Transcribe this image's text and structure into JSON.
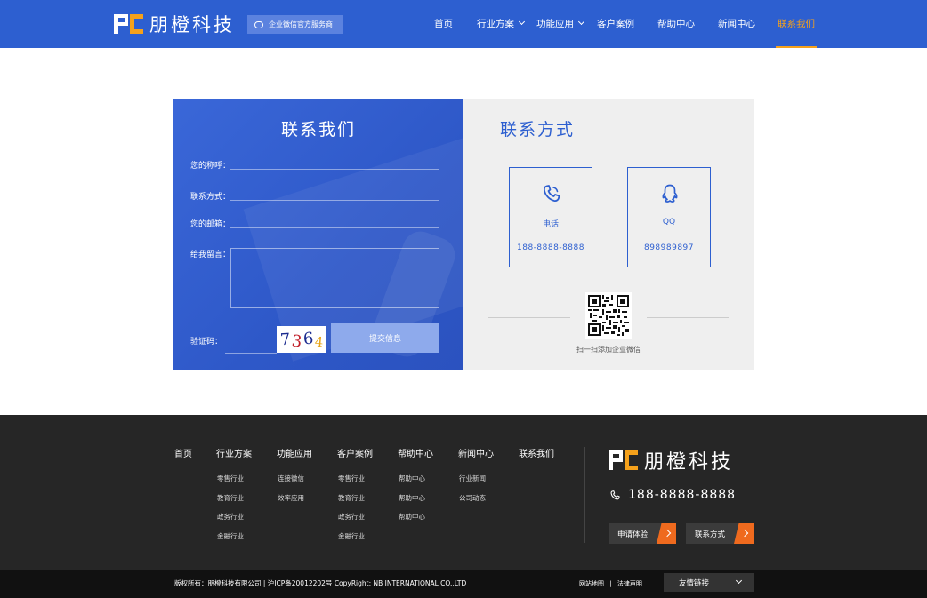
{
  "header": {
    "brand": "朋橙科技",
    "service_badge": "企业微信官方服务商",
    "nav": [
      {
        "label": "首页"
      },
      {
        "label": "行业方案"
      },
      {
        "label": "功能应用"
      },
      {
        "label": "客户案例"
      },
      {
        "label": "帮助中心"
      },
      {
        "label": "新闻中心"
      },
      {
        "label": "联系我们"
      }
    ],
    "active_nav": "联系我们",
    "colors": {
      "primary": "#2d5fd0",
      "accent": "#f5a11b"
    }
  },
  "contact_form": {
    "title": "联系我们",
    "name_label": "您的称呼：",
    "phone_label": "联系方式：",
    "email_label": "您的邮箱：",
    "message_label": "给我留言：",
    "captcha_label": "验证码：",
    "captcha_digits": [
      "7",
      "3",
      "6",
      "4"
    ],
    "submit_label": "提交信息"
  },
  "contact_info": {
    "title": "联系方式",
    "phone": {
      "label": "电话",
      "value": "188-8888-8888",
      "icon": "phone-icon"
    },
    "qq": {
      "label": "QQ",
      "value": "898989897",
      "icon": "qq-icon"
    },
    "qr_caption": "扫一扫添加企业微信"
  },
  "footer": {
    "columns": [
      {
        "title": "首页",
        "items": []
      },
      {
        "title": "行业方案",
        "items": [
          "零售行业",
          "教育行业",
          "政务行业",
          "金融行业"
        ]
      },
      {
        "title": "功能应用",
        "items": [
          "连接微信",
          "效率应用"
        ]
      },
      {
        "title": "客户案例",
        "items": [
          "零售行业",
          "教育行业",
          "政务行业",
          "金融行业"
        ]
      },
      {
        "title": "帮助中心",
        "items": [
          "帮助中心",
          "帮助中心",
          "帮助中心"
        ]
      },
      {
        "title": "新闻中心",
        "items": [
          "行业新闻",
          "公司动态"
        ]
      },
      {
        "title": "联系我们",
        "items": []
      }
    ],
    "brand": "朋橙科技",
    "phone": "188-8888-8888",
    "trial_button": "申请体验",
    "contact_button": "联系方式",
    "accent": "#ef6a1e"
  },
  "bottom": {
    "copyright": "版权所有：朋橙科技有限公司 | 沪ICP备20012202号  CopyRight: NB INTERNATIONAL CO.,LTD",
    "sitemap": "网站地图",
    "separator": "|",
    "legal": "法律声明",
    "friend_links": "友情链接"
  }
}
